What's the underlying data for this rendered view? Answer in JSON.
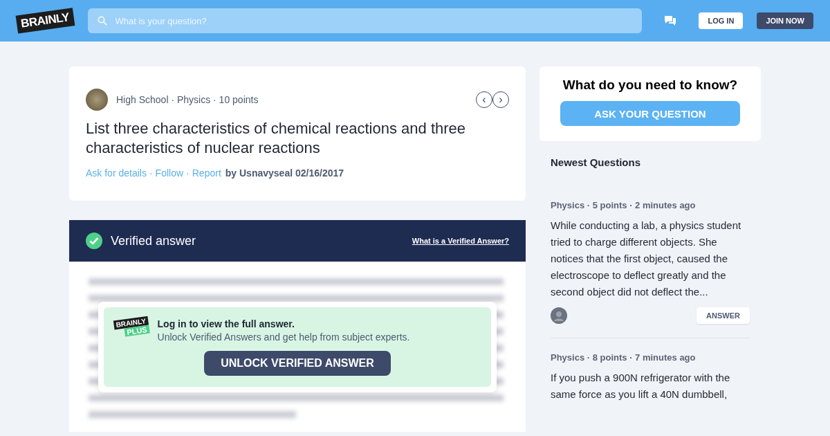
{
  "header": {
    "logo": "BRAINLY",
    "search": {
      "placeholder": "What is your question?"
    },
    "login": "LOG IN",
    "join": "JOIN NOW"
  },
  "question": {
    "meta": "High School · Physics · 10 points",
    "separator": "·",
    "title": "List three characteristics of chemical reactions and three characteristics of nuclear reactions",
    "links": [
      "Ask for details",
      "Follow",
      "Report"
    ],
    "byline": "by Usnavyseal 02/16/2017",
    "nav": [
      "‹",
      "›"
    ]
  },
  "answer": {
    "title": "Verified answer",
    "link": "What is a Verified Answer?",
    "locked": true,
    "unlock": {
      "logo_top": "BRAINLY",
      "logo_bottom": "PLUS",
      "heading": "Log in to view the full answer.",
      "text": "Unlock Verified Answers and get help from subject experts.",
      "button": "UNLOCK VERIFIED ANSWER"
    }
  },
  "ask": {
    "title": "What do you need to know?",
    "button": "ASK YOUR QUESTION"
  },
  "newest": {
    "title": "Newest Questions",
    "items": [
      {
        "meta": "Physics · 5 points · 2 minutes ago",
        "text": "While conducting a lab, a physics student tried to charge different objects. She notices that the first object, caused the electroscope to deflect greatly and the second object did not deflect the...",
        "button": "ANSWER"
      },
      {
        "meta": "Physics · 8 points · 7 minutes ago",
        "text": "If you push a 900N refrigerator with the same force as you lift a 40N dumbbell,"
      }
    ]
  }
}
